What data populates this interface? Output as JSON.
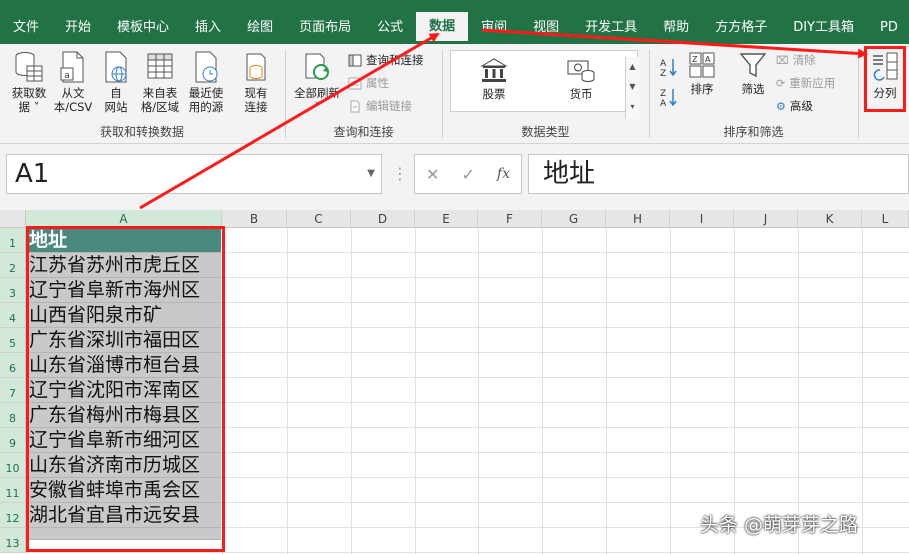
{
  "ribbon_tabs": [
    {
      "label": "文件",
      "active": false
    },
    {
      "label": "开始",
      "active": false
    },
    {
      "label": "模板中心",
      "active": false
    },
    {
      "label": "插入",
      "active": false
    },
    {
      "label": "绘图",
      "active": false
    },
    {
      "label": "页面布局",
      "active": false
    },
    {
      "label": "公式",
      "active": false
    },
    {
      "label": "数据",
      "active": true
    },
    {
      "label": "审阅",
      "active": false
    },
    {
      "label": "视图",
      "active": false
    },
    {
      "label": "开发工具",
      "active": false
    },
    {
      "label": "帮助",
      "active": false
    },
    {
      "label": "方方格子",
      "active": false
    },
    {
      "label": "DIY工具箱",
      "active": false
    },
    {
      "label": "PD",
      "active": false
    }
  ],
  "groups": {
    "get_transform": {
      "label": "获取和转换数据",
      "buttons": {
        "get_data": {
          "line1": "获取数",
          "line2": "据 ˅"
        },
        "from_csv": {
          "line1": "从文",
          "line2": "本/CSV"
        },
        "from_web": {
          "line1": "自",
          "line2": "网站"
        },
        "from_table": {
          "line1": "来自表",
          "line2": "格/区域"
        },
        "recent_sources": {
          "line1": "最近使",
          "line2": "用的源"
        },
        "existing_conn": {
          "line1": "现有",
          "line2": "连接"
        }
      }
    },
    "queries": {
      "label": "查询和连接",
      "refresh_all": {
        "line1": "全部刷新",
        "line2": "˅"
      },
      "queries_conn": "查询和连接",
      "properties": "属性",
      "edit_links": "编辑链接"
    },
    "data_types": {
      "label": "数据类型",
      "stocks": "股票",
      "currency": "货币"
    },
    "sort_filter": {
      "label": "排序和筛选",
      "sort": "排序",
      "filter": "筛选",
      "clear": "清除",
      "reapply": "重新应用",
      "advanced": "高级"
    },
    "data_tools": {
      "text_to_columns": "分列"
    }
  },
  "formula_bar": {
    "name_box": "A1",
    "cancel": "✕",
    "enter": "✓",
    "fx": "fx",
    "value": "地址"
  },
  "grid": {
    "columns": [
      "A",
      "B",
      "C",
      "D",
      "E",
      "F",
      "G",
      "H",
      "I",
      "J",
      "K",
      "L"
    ],
    "row_numbers": [
      "1",
      "2",
      "3",
      "4",
      "5",
      "6",
      "7",
      "8",
      "9",
      "10",
      "11",
      "12",
      "13"
    ],
    "column_a": [
      "地址",
      "江苏省苏州市虎丘区",
      "辽宁省阜新市海州区",
      "山西省阳泉市矿",
      "广东省深圳市福田区",
      "山东省淄博市桓台县",
      "辽宁省沈阳市浑南区",
      "广东省梅州市梅县区",
      "辽宁省阜新市细河区",
      "山东省济南市历城区",
      "安徽省蚌埠市禹会区",
      "湖北省宜昌市远安县",
      ""
    ]
  },
  "watermark": "头条 @萌芽芽之路",
  "colors": {
    "excel_green": "#217346",
    "header_cell": "#4a8a7e",
    "selection_gray": "#c9c9c9",
    "annotation_red": "#ff1a1a"
  }
}
